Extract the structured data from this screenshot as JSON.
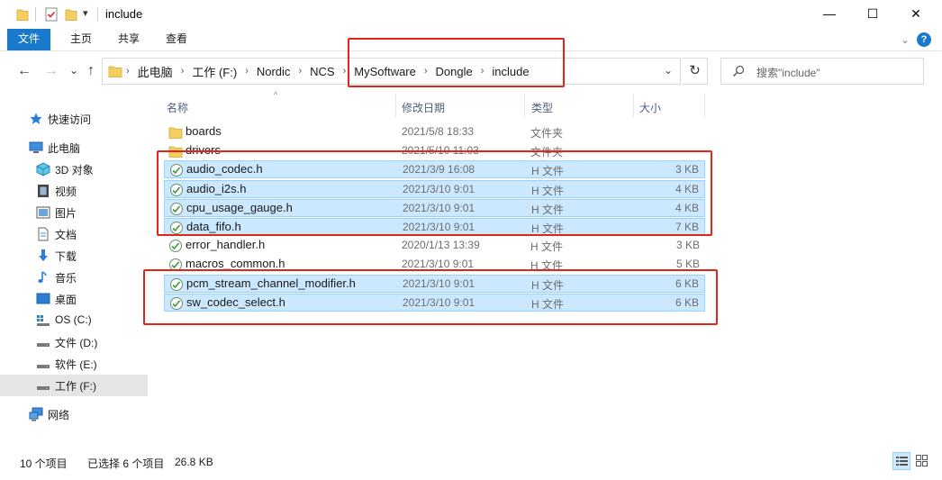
{
  "window": {
    "title": "include",
    "minimize": "—",
    "maximize": "☐",
    "close": "✕"
  },
  "ribbon": {
    "tabs": [
      "文件",
      "主页",
      "共享",
      "查看"
    ],
    "collapse_icon": "chevron-down-icon",
    "help_icon": "help-icon",
    "help_glyph": "?"
  },
  "nav": {
    "back": "←",
    "forward": "→",
    "recent": "⌄",
    "up": "↑",
    "breadcrumb": [
      "此电脑",
      "工作 (F:)",
      "Nordic",
      "NCS",
      "MySoftware",
      "Dongle",
      "include"
    ],
    "refresh": "↻",
    "search_placeholder": "搜索\"include\""
  },
  "sidebar": {
    "items": [
      {
        "label": "快速访问",
        "icon": "star-icon"
      },
      {
        "label": "此电脑",
        "icon": "computer-icon"
      },
      {
        "label": "3D 对象",
        "icon": "cube-icon"
      },
      {
        "label": "视频",
        "icon": "video-icon"
      },
      {
        "label": "图片",
        "icon": "picture-icon"
      },
      {
        "label": "文档",
        "icon": "document-icon"
      },
      {
        "label": "下载",
        "icon": "download-icon"
      },
      {
        "label": "音乐",
        "icon": "music-icon"
      },
      {
        "label": "桌面",
        "icon": "desktop-icon"
      },
      {
        "label": "OS (C:)",
        "icon": "os-drive-icon"
      },
      {
        "label": "文件 (D:)",
        "icon": "drive-icon"
      },
      {
        "label": "软件 (E:)",
        "icon": "drive-icon"
      },
      {
        "label": "工作 (F:)",
        "icon": "drive-icon"
      },
      {
        "label": "网络",
        "icon": "network-icon"
      }
    ]
  },
  "columns": {
    "name": "名称",
    "date": "修改日期",
    "type": "类型",
    "size": "大小"
  },
  "files": [
    {
      "name": "boards",
      "date": "2021/5/8 18:33",
      "type": "文件夹",
      "size": "",
      "kind": "folder",
      "selected": false
    },
    {
      "name": "drivers",
      "date": "2021/5/10 11:03",
      "type": "文件夹",
      "size": "",
      "kind": "folder",
      "selected": false
    },
    {
      "name": "audio_codec.h",
      "date": "2021/3/9 16:08",
      "type": "H 文件",
      "size": "3 KB",
      "kind": "h",
      "selected": true
    },
    {
      "name": "audio_i2s.h",
      "date": "2021/3/10 9:01",
      "type": "H 文件",
      "size": "4 KB",
      "kind": "h",
      "selected": true
    },
    {
      "name": "cpu_usage_gauge.h",
      "date": "2021/3/10 9:01",
      "type": "H 文件",
      "size": "4 KB",
      "kind": "h",
      "selected": true
    },
    {
      "name": "data_fifo.h",
      "date": "2021/3/10 9:01",
      "type": "H 文件",
      "size": "7 KB",
      "kind": "h",
      "selected": true
    },
    {
      "name": "error_handler.h",
      "date": "2020/1/13 13:39",
      "type": "H 文件",
      "size": "3 KB",
      "kind": "h",
      "selected": false
    },
    {
      "name": "macros_common.h",
      "date": "2021/3/10 9:01",
      "type": "H 文件",
      "size": "5 KB",
      "kind": "h",
      "selected": false
    },
    {
      "name": "pcm_stream_channel_modifier.h",
      "date": "2021/3/10 9:01",
      "type": "H 文件",
      "size": "6 KB",
      "kind": "h",
      "selected": true
    },
    {
      "name": "sw_codec_select.h",
      "date": "2021/3/10 9:01",
      "type": "H 文件",
      "size": "6 KB",
      "kind": "h",
      "selected": true
    }
  ],
  "status": {
    "count": "10 个项目",
    "selection": "已选择 6 个项目",
    "size": "26.8 KB"
  },
  "colors": {
    "accent": "#1979ca",
    "selection": "#cce8ff",
    "annotation": "#e0261b"
  }
}
